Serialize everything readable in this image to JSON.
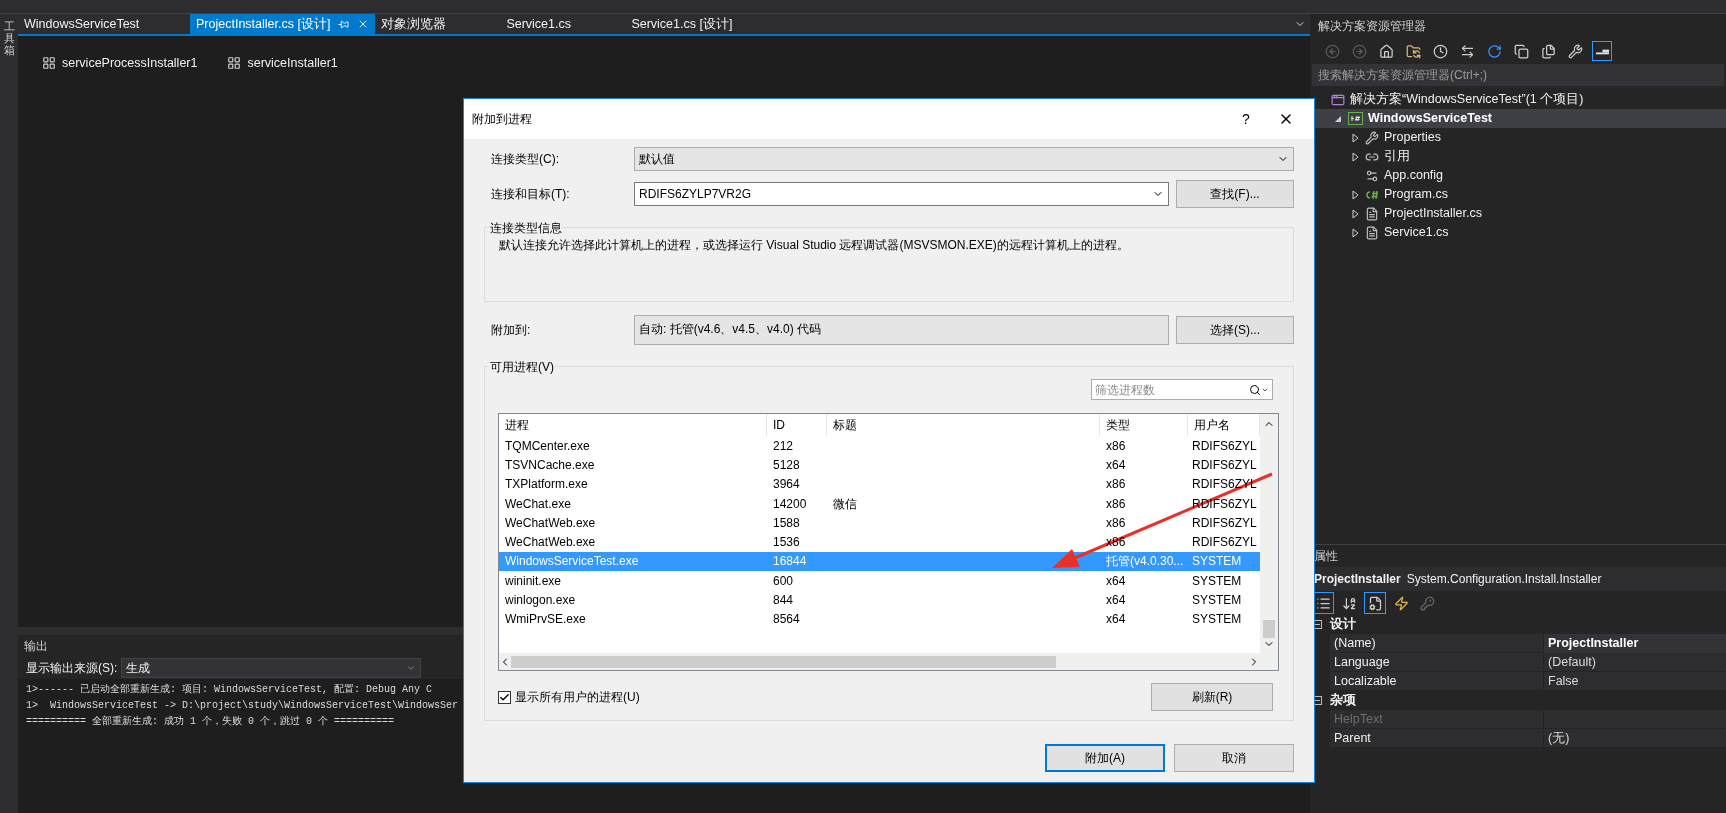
{
  "toolbox_strip": {
    "label": "工具箱"
  },
  "editor_tabs": [
    {
      "label": "WindowsServiceTest",
      "selected": false
    },
    {
      "label": "ProjectInstaller.cs [设计]",
      "selected": true
    },
    {
      "label": "对象浏览器",
      "selected": false
    },
    {
      "label": "Service1.cs",
      "selected": false
    },
    {
      "label": "Service1.cs [设计]",
      "selected": false
    }
  ],
  "designer": {
    "components": [
      {
        "label": "serviceProcessInstaller1"
      },
      {
        "label": "serviceInstaller1"
      }
    ]
  },
  "output": {
    "title": "输出",
    "source_label": "显示输出来源(S):",
    "source_value": "生成",
    "lines": [
      "1>------ 已启动全部重新生成: 项目: WindowsServiceTest, 配置: Debug Any C",
      "1>  WindowsServiceTest -> D:\\project\\study\\WindowsServiceTest\\WindowsSer",
      "========== 全部重新生成: 成功 1 个，失败 0 个，跳过 0 个 =========="
    ]
  },
  "dialog": {
    "title": "附加到进程",
    "help": "?",
    "connection_type": {
      "label": "连接类型(C):",
      "value": "默认值"
    },
    "connection_target": {
      "label": "连接和目标(T):",
      "value": "RDIFS6ZYLP7VR2G",
      "button": "查找(F)..."
    },
    "info_group": {
      "title": "连接类型信息",
      "text": "默认连接允许选择此计算机上的进程，或选择运行 Visual Studio 远程调试器(MSVSMON.EXE)的远程计算机上的进程。"
    },
    "attach_to": {
      "label": "附加到:",
      "value": "自动: 托管(v4.6、v4.5、v4.0) 代码",
      "button": "选择(S)..."
    },
    "processes": {
      "title": "可用进程(V)",
      "filter_placeholder": "筛选进程数",
      "columns": [
        "进程",
        "ID",
        "标题",
        "类型",
        "用户名"
      ],
      "rows": [
        {
          "cells": [
            "TQMCenter.exe",
            "212",
            "",
            "x86",
            "RDIFS6ZYL"
          ],
          "selected": false
        },
        {
          "cells": [
            "TSVNCache.exe",
            "5128",
            "",
            "x64",
            "RDIFS6ZYL"
          ],
          "selected": false
        },
        {
          "cells": [
            "TXPlatform.exe",
            "3964",
            "",
            "x86",
            "RDIFS6ZYL"
          ],
          "selected": false
        },
        {
          "cells": [
            "WeChat.exe",
            "14200",
            "微信",
            "x86",
            "RDIFS6ZYL"
          ],
          "selected": false
        },
        {
          "cells": [
            "WeChatWeb.exe",
            "1588",
            "",
            "x86",
            "RDIFS6ZYL"
          ],
          "selected": false
        },
        {
          "cells": [
            "WeChatWeb.exe",
            "1536",
            "",
            "x86",
            "RDIFS6ZYL"
          ],
          "selected": false
        },
        {
          "cells": [
            "WindowsServiceTest.exe",
            "16844",
            "",
            "托管(v4.0.30...",
            "SYSTEM"
          ],
          "selected": true
        },
        {
          "cells": [
            "wininit.exe",
            "600",
            "",
            "x64",
            "SYSTEM"
          ],
          "selected": false
        },
        {
          "cells": [
            "winlogon.exe",
            "844",
            "",
            "x64",
            "SYSTEM"
          ],
          "selected": false
        },
        {
          "cells": [
            "WmiPrvSE.exe",
            "8564",
            "",
            "x64",
            "SYSTEM"
          ],
          "selected": false
        }
      ],
      "show_all_users": {
        "label": "显示所有用户的进程(U)",
        "checked": true
      },
      "refresh": "刷新(R)"
    },
    "buttons": [
      {
        "label": "附加(A)",
        "default": true
      },
      {
        "label": "取消",
        "default": false
      }
    ]
  },
  "solution_explorer": {
    "title": "解决方案资源管理器",
    "toolbar": [
      {
        "kind": "back",
        "selected": false
      },
      {
        "kind": "forward",
        "selected": false
      },
      {
        "kind": "home",
        "selected": false
      },
      {
        "kind": "switch-views",
        "selected": false
      },
      {
        "kind": "history",
        "selected": false
      },
      {
        "kind": "sync",
        "selected": false
      },
      {
        "kind": "refresh",
        "selected": false
      },
      {
        "kind": "collapse",
        "selected": false
      },
      {
        "kind": "show-all",
        "selected": false
      },
      {
        "kind": "properties",
        "selected": false
      },
      {
        "kind": "preview",
        "selected": true
      }
    ],
    "search_placeholder": "搜索解决方案资源管理器(Ctrl+;)",
    "tree": [
      {
        "label": "解决方案“WindowsServiceTest”(1 个项目)",
        "kind": "solution",
        "selected": false,
        "children": [
          {
            "label": "WindowsServiceTest",
            "kind": "project",
            "expanded": true,
            "selected": true,
            "children": [
              {
                "label": "Properties",
                "kind": "properties",
                "expanded": false,
                "selected": false
              },
              {
                "label": "引用",
                "kind": "references",
                "expanded": false,
                "selected": false
              },
              {
                "label": "App.config",
                "kind": "config",
                "selected": false
              },
              {
                "label": "Program.cs",
                "kind": "csharp",
                "expanded": false,
                "selected": false
              },
              {
                "label": "ProjectInstaller.cs",
                "kind": "file",
                "expanded": false,
                "selected": false
              },
              {
                "label": "Service1.cs",
                "kind": "file",
                "expanded": false,
                "selected": false
              }
            ]
          }
        ]
      }
    ]
  },
  "properties": {
    "title": "属性",
    "object_name": "ProjectInstaller",
    "object_type": "System.Configuration.Install.Installer",
    "toolbar": [
      {
        "kind": "categorized",
        "selected": true
      },
      {
        "kind": "alphabetical",
        "selected": false
      },
      {
        "kind": "property-pages",
        "selected": true
      },
      {
        "kind": "events",
        "selected": false
      },
      {
        "kind": "key",
        "selected": false
      }
    ],
    "categories": [
      {
        "name": "设计",
        "expanded": true,
        "rows": [
          {
            "name": "(Name)",
            "value": "ProjectInstaller",
            "modified": true,
            "disabled": false
          },
          {
            "name": "Language",
            "value": "(Default)",
            "modified": false,
            "disabled": false
          },
          {
            "name": "Localizable",
            "value": "False",
            "modified": false,
            "disabled": false
          }
        ]
      },
      {
        "name": "杂项",
        "expanded": true,
        "rows": [
          {
            "name": "HelpText",
            "value": "",
            "modified": false,
            "disabled": true
          },
          {
            "name": "Parent",
            "value": "(无)",
            "modified": false,
            "disabled": false
          }
        ]
      }
    ]
  }
}
